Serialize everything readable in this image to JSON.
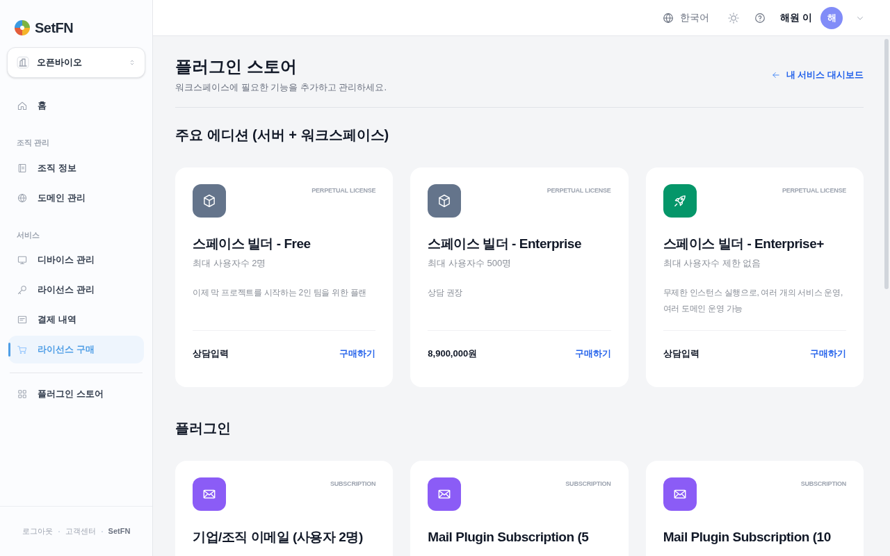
{
  "sidebar": {
    "logo": "SetFN",
    "org": {
      "name": "오픈바이오"
    },
    "sections": [
      {
        "items": [
          {
            "kind": "home",
            "label": "홈",
            "selected": false
          }
        ]
      },
      {
        "heading": "조직 관리",
        "items": [
          {
            "kind": "doc",
            "label": "조직 정보",
            "selected": false
          },
          {
            "kind": "globe",
            "label": "도메인 관리",
            "selected": false
          }
        ]
      },
      {
        "heading": "서비스",
        "items": [
          {
            "kind": "monitor",
            "label": "디바이스 관리",
            "selected": false
          },
          {
            "kind": "key",
            "label": "라이선스 관리",
            "selected": false
          },
          {
            "kind": "receipt",
            "label": "결제 내역",
            "selected": false
          },
          {
            "kind": "cart",
            "label": "라이선스 구매",
            "selected": true
          }
        ]
      },
      {
        "divider": true,
        "items": [
          {
            "kind": "grid",
            "label": "플러그인 스토어",
            "selected": false
          }
        ]
      }
    ],
    "footer_links": [
      "로그아웃",
      "고객센터",
      "SetFN"
    ]
  },
  "header": {
    "language": "한국어",
    "user_name": "해원 이",
    "avatar": "해"
  },
  "page": {
    "title": "플러그인 스토어",
    "subtitle": "워크스페이스에 필요한 기능을 추가하고 관리하세요.",
    "back_link": "내 서비스 대시보드",
    "sections": [
      {
        "title": "주요 에디션 (서버 + 워크스페이스)",
        "cards": [
          {
            "kind": "cube",
            "color": "#64748b",
            "license": "PERPETUAL LICENSE",
            "title": "스페이스 빌더 - Free",
            "subtitle": "최대 사용자수 2명",
            "description": "이제 막 프로젝트를 시작하는 2인 팀을 위한 플랜",
            "price": "상담입력",
            "action": "구매하기"
          },
          {
            "kind": "cube",
            "color": "#64748b",
            "license": "PERPETUAL LICENSE",
            "title": "스페이스 빌더 - Enterprise",
            "subtitle": "최대 사용자수 500명",
            "description": "상담 권장",
            "price": "8,900,000원",
            "action": "구매하기"
          },
          {
            "kind": "rocket",
            "color": "#059669",
            "license": "PERPETUAL LICENSE",
            "title": "스페이스 빌더 - Enterprise+",
            "subtitle": "최대 사용자수 제한 없음",
            "description": "무제한 인스턴스 실행으로, 여러 개의 서비스 운영, 여러 도메인 운영 가능",
            "price": "상담입력",
            "action": "구매하기"
          }
        ]
      },
      {
        "title": "플러그인",
        "cards": [
          {
            "kind": "mail",
            "color": "#8b5cf6",
            "license": "SUBSCRIPTION",
            "title": "기업/조직 이메일 (사용자 2명)"
          },
          {
            "kind": "mail",
            "color": "#8b5cf6",
            "license": "SUBSCRIPTION",
            "title": "Mail Plugin Subscription (5"
          },
          {
            "kind": "mail",
            "color": "#8b5cf6",
            "license": "SUBSCRIPTION",
            "title": "Mail Plugin Subscription (10"
          }
        ]
      }
    ]
  }
}
